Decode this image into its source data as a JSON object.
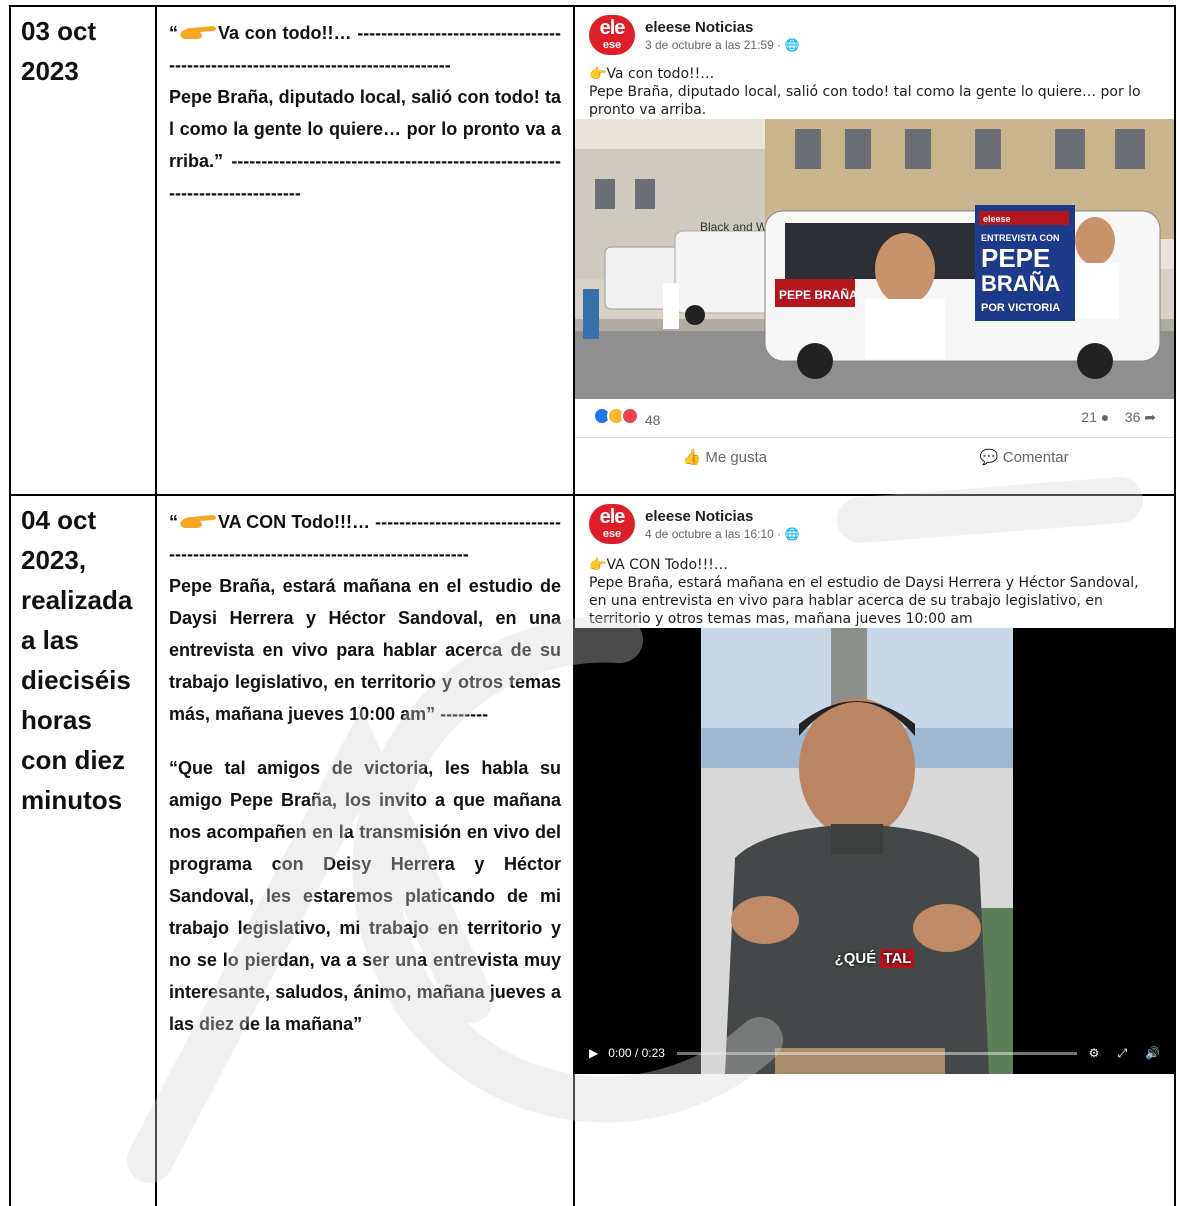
{
  "rows": [
    {
      "date": "03 oct 2023",
      "quote_open": "“",
      "text_main": "Va con todo!!… ---------------------------------------------------------------------------------",
      "text_body": "Pepe Braña, diputado local, salió con todo! tal como la gente lo quiere… por lo pronto va arriba.” -----------------------------------------------------------------------------",
      "post": {
        "page_name": "eleese Noticias",
        "timestamp": "3 de octubre a las 21:59 · ",
        "line1": "Va con todo!!…",
        "line2": "Pepe Braña, diputado local, salió con todo! tal como la gente lo quiere… por lo pronto va arriba.",
        "reactions_count": "48",
        "comments_count": "21",
        "shares_count": "36",
        "like_label": "Me gusta",
        "comment_label": "Comentar",
        "bus_sign": "Black and White",
        "banner_top": "ENTREVISTA CON",
        "banner_name1": "PEPE",
        "banner_name2": "BRAÑA",
        "banner_small": "POR VICTORIA",
        "bus_side_name": "PEPE BRAÑA",
        "banner_brand": "eleese"
      }
    },
    {
      "date": "04 oct 2023, realizada a las dieciséis horas con diez minutos",
      "quote_open": "“",
      "text_main": "VA CON Todo!!!… ---------------------------------------------------------------------------------",
      "text_body": "Pepe Braña, estará mañana en el estudio de Daysi Herrera y Héctor Sandoval, en una entrevista en vivo para hablar acerca de su trabajo legislativo, en territorio y otros temas más, mañana jueves 10:00 am” --------",
      "text_quote": "“Que tal amigos de victoria, les habla su amigo Pepe Braña, los invito a que mañana nos acompañen en la transmisión en vivo del programa con Deisy Herrera y Héctor Sandoval, les estaremos platicando de mi trabajo legislativo, mi trabajo en territorio y no se lo pierdan, va a ser una entrevista muy interesante, saludos, ánimo, mañana jueves a las diez de la mañana”",
      "post": {
        "page_name": "eleese Noticias",
        "timestamp": "4 de octubre a las 16:10 · ",
        "line1": "VA CON Todo!!!…",
        "line2": "Pepe Braña, estará mañana en el estudio de Daysi Herrera y Héctor Sandoval, en una entrevista en vivo para hablar acerca de su trabajo legislativo, en territorio y otros temas mas, mañana jueves 10:00 am",
        "caption_a": "¿QUÉ",
        "caption_b": "TAL",
        "video_time": "0:00 / 0:23"
      }
    }
  ],
  "logo": {
    "top": "ele",
    "bottom": "ese"
  },
  "colors": {
    "brand_red": "#e01e28",
    "fb_text": "#1c1e21",
    "fb_meta": "#65676b",
    "border": "#000000"
  },
  "icons": [
    "pointing-hand-icon",
    "globe-icon",
    "like-icon",
    "comment-icon",
    "comment-bubble-icon",
    "share-arrow-icon",
    "play-icon",
    "gear-icon",
    "fullscreen-icon",
    "volume-icon"
  ]
}
